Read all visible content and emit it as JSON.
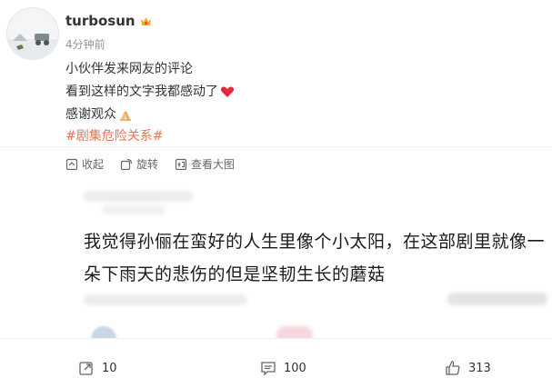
{
  "user": {
    "name": "turbosun",
    "time": "4分钟前"
  },
  "post": {
    "lines": [
      "小伙伴发来网友的评论",
      "看到这样的文字我都感动了",
      "感谢观众"
    ],
    "hashtag": "#剧集危险关系#"
  },
  "tools": {
    "collect": "收起",
    "rotate": "旋转",
    "view_large": "查看大图"
  },
  "screenshot": {
    "text": "我觉得孙俪在蛮好的人生里像个小太阳，在这部剧里就像一朵下雨天的悲伤的但是坚韧生长的蘑菇"
  },
  "actions": {
    "repost": "10",
    "comment": "100",
    "like": "313"
  },
  "colors": {
    "hashtag": "#eb7350",
    "heart": "#e02b38"
  }
}
